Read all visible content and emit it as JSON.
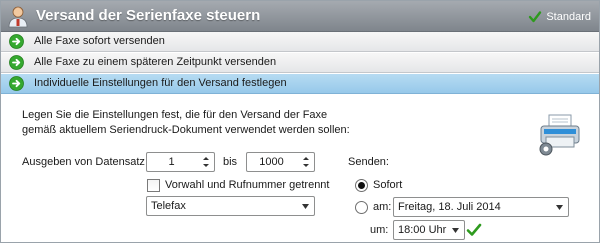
{
  "header": {
    "title": "Versand der Serienfaxe steuern",
    "standard_label": "Standard",
    "icon": "fax-user-icon"
  },
  "options": [
    {
      "label": "Alle Faxe sofort versenden",
      "selected": false
    },
    {
      "label": "Alle Faxe zu einem späteren Zeitpunkt versenden",
      "selected": false
    },
    {
      "label": "Individuelle Einstellungen für den Versand festlegen",
      "selected": true
    }
  ],
  "content": {
    "description_line1": "Legen Sie die Einstellungen fest, die für den Versand der Faxe",
    "description_line2": "gemäß aktuellem Seriendruck-Dokument verwendet werden sollen:",
    "records_label": "Ausgeben von Datensatz",
    "records_from": "1",
    "records_to_label": "bis",
    "records_to": "1000",
    "separate_checkbox_label": "Vorwahl und Rufnummer getrennt",
    "separate_checked": false,
    "field_combo_value": "Telefax",
    "send_label": "Senden:",
    "send_now_label": "Sofort",
    "send_now_selected": true,
    "send_at_label": "am:",
    "send_date": "Freitag, 18. Juli 2014",
    "time_label": "um:",
    "send_time": "18:00 Uhr"
  },
  "colors": {
    "header_bg": "#8c9197",
    "selected_row": "#a8d3ef",
    "arrow_green": "#35a82f",
    "check_green": "#2e9a1e"
  }
}
